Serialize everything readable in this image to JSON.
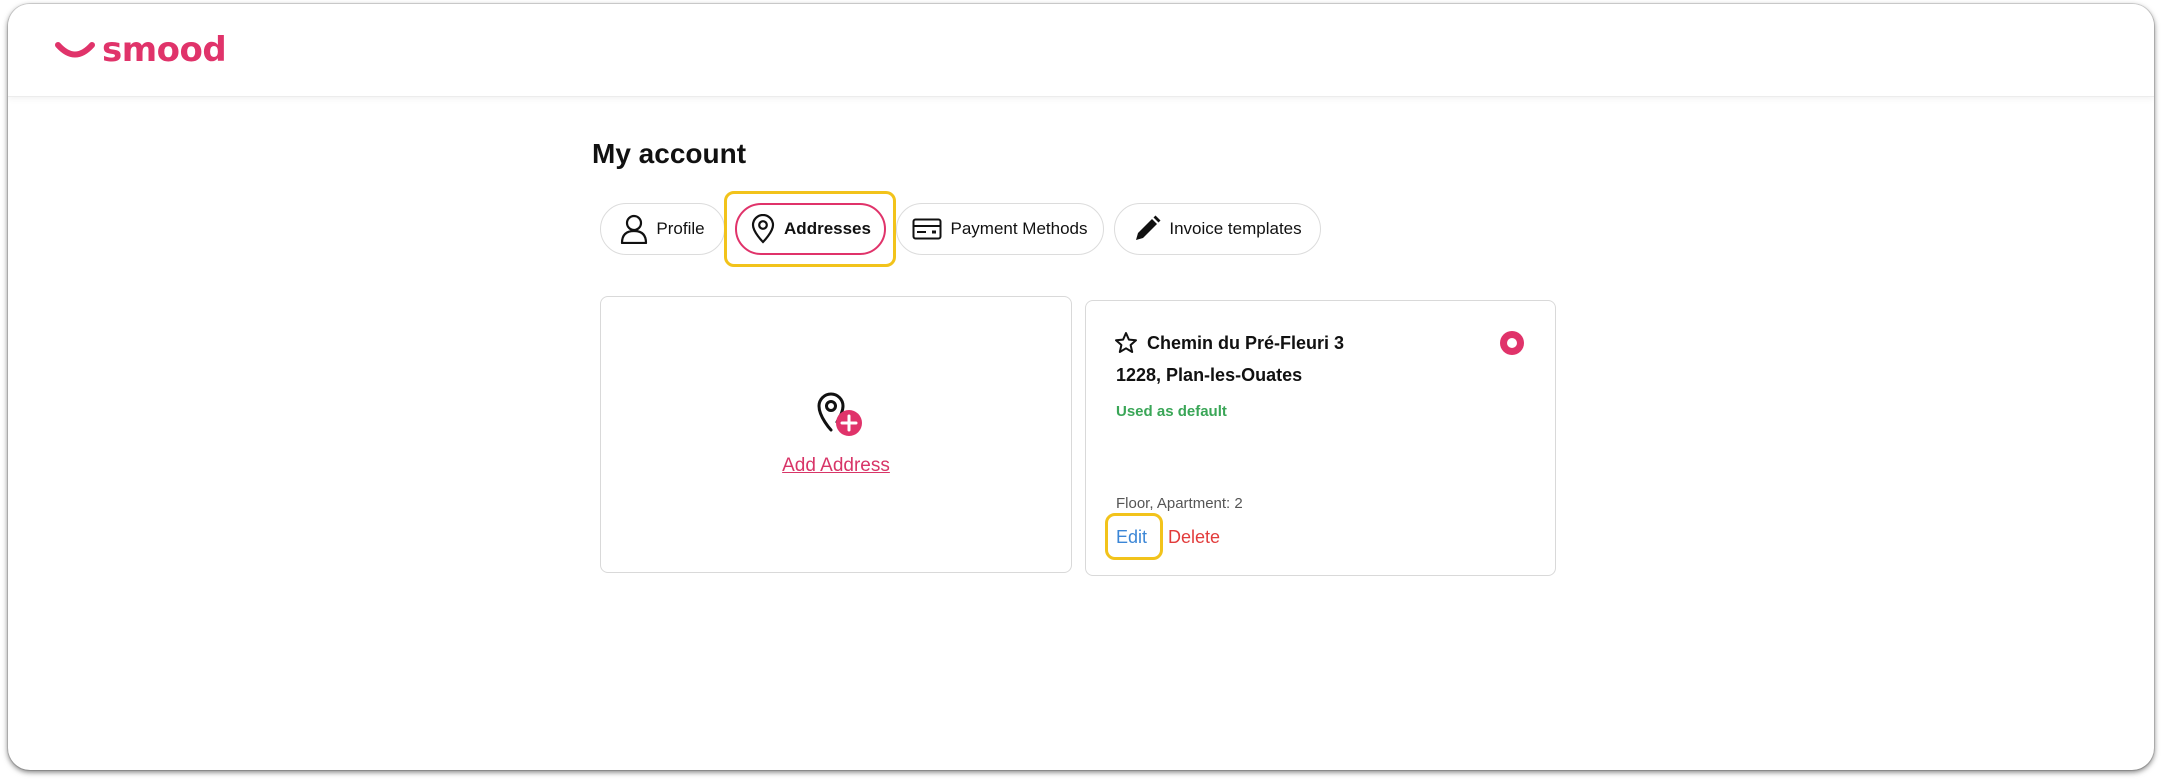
{
  "brand": {
    "name": "smood",
    "color": "#e0336a"
  },
  "page": {
    "title": "My account"
  },
  "tabs": [
    {
      "label": "Profile",
      "icon": "user-icon",
      "active": false
    },
    {
      "label": "Addresses",
      "icon": "location-pin-icon",
      "active": true
    },
    {
      "label": "Payment Methods",
      "icon": "credit-card-icon",
      "active": false
    },
    {
      "label": "Invoice templates",
      "icon": "pencil-icon",
      "active": false
    }
  ],
  "add_card": {
    "label": "Add Address",
    "icon": "location-pin-plus-icon"
  },
  "address": {
    "street": "Chemin du Pré-Fleuri 3",
    "city": "1228, Plan-les-Ouates",
    "default_label": "Used as default",
    "floor": "Floor, Apartment: 2",
    "edit_label": "Edit",
    "delete_label": "Delete",
    "star_icon": "star-outline-icon",
    "selected": true
  },
  "colors": {
    "accent": "#e0336a",
    "default_green": "#3aa657",
    "edit_blue": "#3b86d6",
    "delete_red": "#e23b3b",
    "highlight": "#f2c31b"
  }
}
